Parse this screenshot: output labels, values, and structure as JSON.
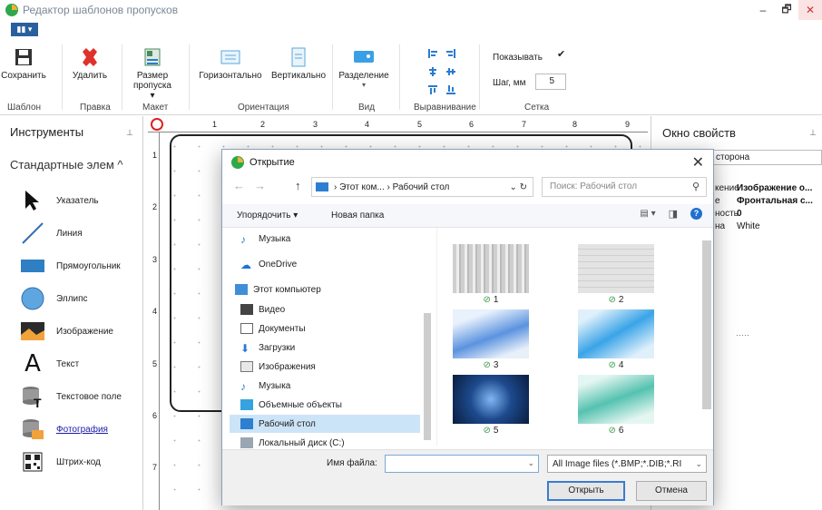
{
  "app": {
    "title": "Редактор шаблонов пропусков",
    "menu_label": "▮▮ ▾"
  },
  "window": {
    "minimize": "–",
    "restore": "🗗",
    "close": "✕"
  },
  "ribbon": {
    "save": "Сохранить",
    "delete": "Удалить",
    "size": "Размер пропуска ▾",
    "horizontal": "Горизонтально",
    "vertical": "Вертикально",
    "split": "Разделение",
    "show": "Показывать",
    "step": "Шаг, мм",
    "step_value": "5",
    "groups": [
      "Шаблон",
      "Правка",
      "Макет",
      "Ориентация",
      "Вид",
      "Выравнивание",
      "Сетка"
    ]
  },
  "tools": {
    "title": "Инструменты",
    "header": "Стандартные элем ^",
    "items": [
      "Указатель",
      "Линия",
      "Прямоугольник",
      "Эллипс",
      "Изображение",
      "Текст",
      "Текстовое поле",
      "Фотография",
      "Штрих-код"
    ]
  },
  "ruler": {
    "h": [
      "1",
      "2",
      "3",
      "4",
      "5",
      "6",
      "7",
      "8",
      "9"
    ],
    "v": [
      "1",
      "2",
      "3",
      "4",
      "5",
      "6",
      "7"
    ]
  },
  "props": {
    "title": "Окно свойств",
    "selected": "сторона",
    "rows": [
      {
        "k": "кение",
        "v": "Изображение о..."
      },
      {
        "k": "е",
        "v": "Фронтальная с..."
      },
      {
        "k": "ность",
        "v": "0"
      },
      {
        "k": "на",
        "v": "White"
      }
    ],
    "dots": "·····"
  },
  "dialog": {
    "title": "Открытие",
    "address": "› Этот ком... › Рабочий стол",
    "search_placeholder": "Поиск: Рабочий стол",
    "organize": "Упорядочить ▾",
    "new_folder": "Новая папка",
    "nav": [
      "Музыка",
      "OneDrive",
      "Этот компьютер",
      "Видео",
      "Документы",
      "Загрузки",
      "Изображения",
      "Музыка",
      "Объемные объекты",
      "Рабочий стол",
      "Локальный диск (C:)"
    ],
    "files": [
      "1",
      "2",
      "3",
      "4",
      "5",
      "6"
    ],
    "filename_label": "Имя файла:",
    "filename_value": "",
    "filter": "All Image files (*.BMP;*.DIB;*.RI",
    "open": "Открыть",
    "cancel": "Отмена"
  }
}
